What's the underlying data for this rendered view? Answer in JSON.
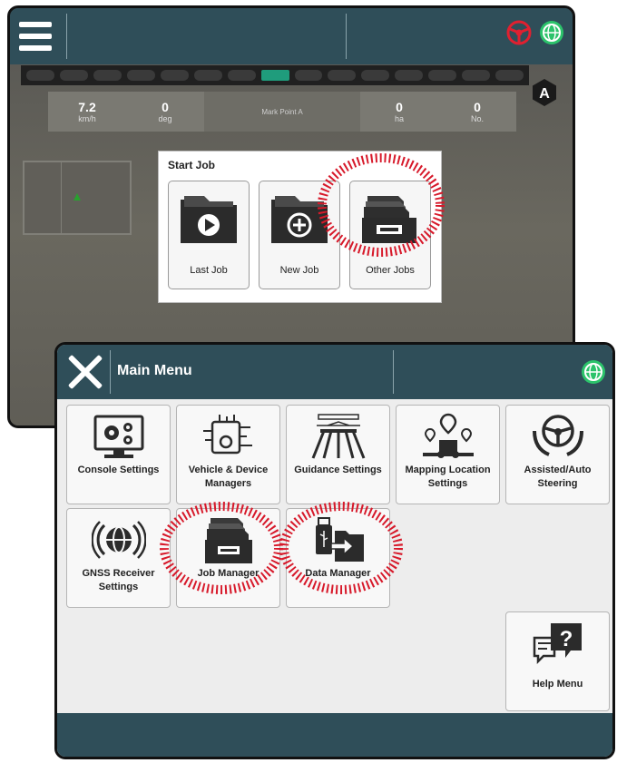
{
  "back_screen": {
    "dashboard": {
      "speed": {
        "value": "7.2",
        "unit": "km/h"
      },
      "heading": {
        "value": "0",
        "unit": "deg"
      },
      "mark": "Mark Point A",
      "area": {
        "value": "0",
        "unit": "ha"
      },
      "count": {
        "value": "0",
        "unit": "No."
      }
    },
    "auto_badge": "A",
    "start_job": {
      "title": "Start Job",
      "buttons": [
        {
          "label": "Last Job",
          "icon": "play-folder-icon"
        },
        {
          "label": "New Job",
          "icon": "plus-folder-icon"
        },
        {
          "label": "Other Jobs",
          "icon": "file-drawer-icon"
        }
      ]
    }
  },
  "main_menu": {
    "title": "Main Menu",
    "tiles": [
      {
        "line1": "Console Settings",
        "line2": "",
        "icon": "console-gears-icon"
      },
      {
        "line1": "Vehicle & Device",
        "line2": "Managers",
        "icon": "vehicle-device-icon"
      },
      {
        "line1": "Guidance Settings",
        "line2": "",
        "icon": "guidance-icon"
      },
      {
        "line1": "Mapping Location",
        "line2": "Settings",
        "icon": "mapping-location-icon"
      },
      {
        "line1": "Assisted/Auto",
        "line2": "Steering",
        "icon": "steering-wheel-icon"
      },
      {
        "line1": "GNSS Receiver",
        "line2": "Settings",
        "icon": "gnss-globe-icon"
      },
      {
        "line1": "Job Manager",
        "line2": "",
        "icon": "file-drawer-icon"
      },
      {
        "line1": "Data Manager",
        "line2": "",
        "icon": "usb-transfer-icon"
      },
      {
        "line1": "Help Menu",
        "line2": "",
        "icon": "help-question-icon"
      }
    ]
  },
  "colors": {
    "bar": "#2f4e59",
    "highlight": "#d7192a",
    "gnss_green": "#2cc36b"
  }
}
